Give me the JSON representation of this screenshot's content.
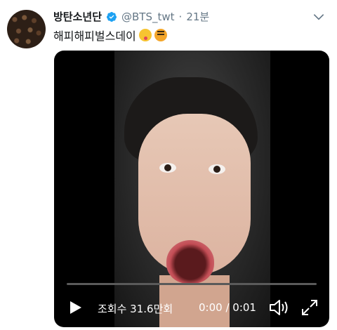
{
  "tweet": {
    "author_name": "방탄소년단",
    "handle": "@BTS_twt",
    "separator": "·",
    "time": "21분",
    "text": "해피해피벌스데이",
    "emojis": [
      "zany-face",
      "tiger-face"
    ]
  },
  "video": {
    "views_label": "조회수 31.6만회",
    "current_time": "0:00",
    "duration": "0:01",
    "time_separator": " / ",
    "progress": 0.0
  },
  "colors": {
    "verified": "#1da1f2",
    "text": "#14171a",
    "muted": "#657786",
    "video_bg": "#000000"
  },
  "icons": {
    "verified": "verified-badge-icon",
    "more": "chevron-down-icon",
    "play": "play-icon",
    "volume": "volume-icon",
    "fullscreen": "fullscreen-icon"
  }
}
